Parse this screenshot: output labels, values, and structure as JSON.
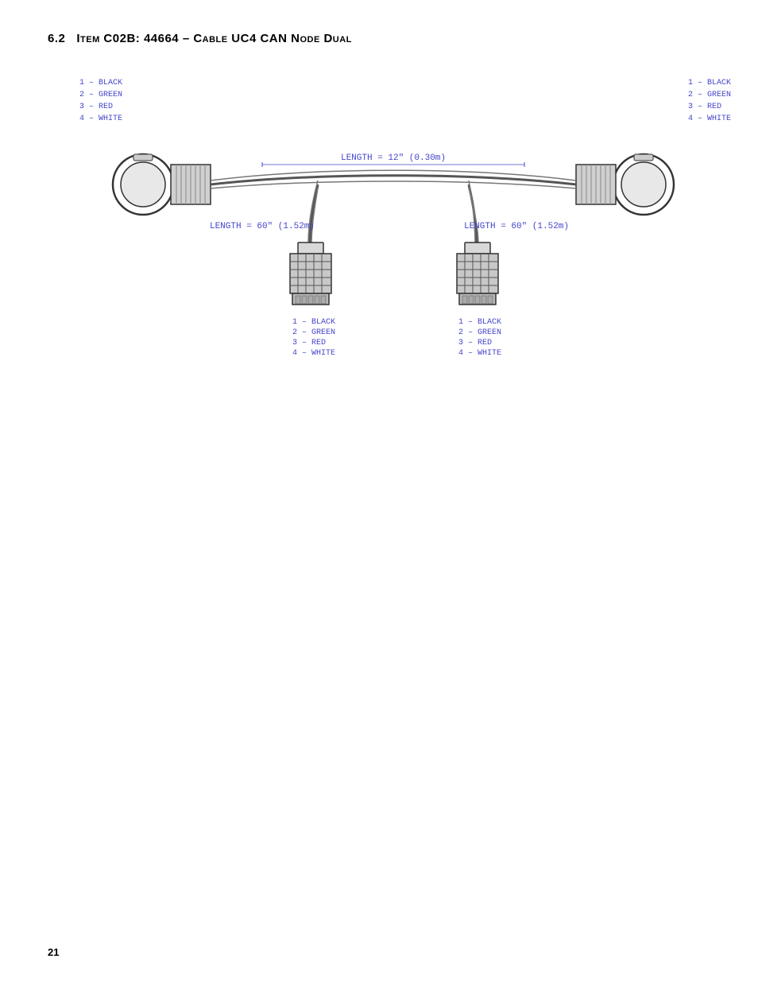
{
  "page": {
    "number": "21",
    "section": {
      "number": "6.2",
      "title": "Item C02B: 44664 – Cable UC4 CAN Node Dual"
    }
  },
  "diagram": {
    "length_top": "LENGTH = 12\" (0.30m)",
    "length_left": "LENGTH = 60\" (1.52m)",
    "length_right": "LENGTH = 60\" (1.52m)",
    "connector_left_label": [
      "1 – BLACK",
      "2 – GREEN",
      "3 – RED",
      "4 – WHITE"
    ],
    "connector_right_label": [
      "1 – BLACK",
      "2 – GREEN",
      "3 – RED",
      "4 – WHITE"
    ],
    "connector_bottom_left_label": [
      "1 – BLACK",
      "2 – GREEN",
      "3 – RED",
      "4 – WHITE"
    ],
    "connector_bottom_right_label": [
      "1 – BLACK",
      "2 – GREEN",
      "3 – RED",
      "4 – WHITE"
    ]
  },
  "colors": {
    "blue": "#4444cc",
    "black": "#000000",
    "dark_gray": "#333333"
  }
}
